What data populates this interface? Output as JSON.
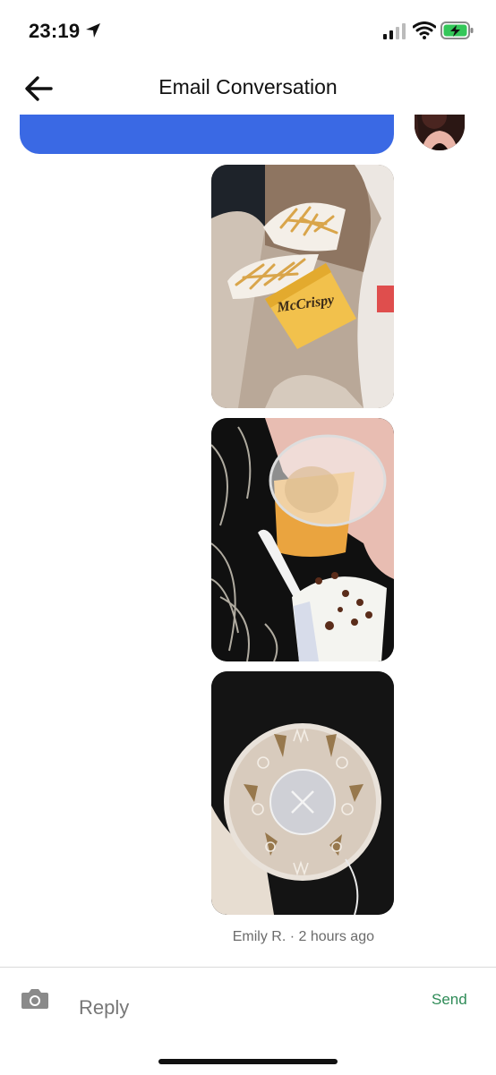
{
  "status_bar": {
    "time": "23:19",
    "icons": [
      "location-arrow-icon",
      "cellular-signal-icon",
      "wifi-icon",
      "battery-charging-icon"
    ],
    "battery_color": "#34c759"
  },
  "nav": {
    "title": "Email Conversation",
    "back_icon": "arrow-left-icon"
  },
  "conversation": {
    "bubble_color": "#3a69e4",
    "photos": [
      {
        "id": "photo-fries-mccrispy",
        "printed_text": "McCrispy"
      },
      {
        "id": "photo-drink-mcflurry"
      },
      {
        "id": "photo-cup-lid"
      }
    ],
    "meta": "Emily R. · 2 hours ago"
  },
  "composer": {
    "camera_icon": "camera-icon",
    "reply_placeholder": "Reply",
    "send_label": "Send",
    "send_color": "#2e8b57"
  }
}
